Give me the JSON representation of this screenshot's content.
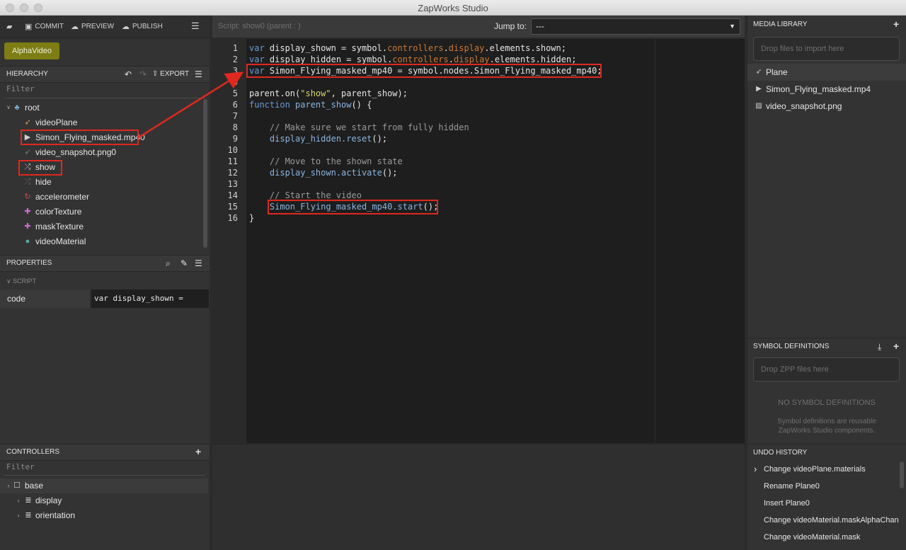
{
  "window": {
    "title": "ZapWorks Studio"
  },
  "toolbar": {
    "commit": "COMMIT",
    "preview": "PREVIEW",
    "publish": "PUBLISH"
  },
  "symbol_button": "AlphaVideo",
  "hierarchy": {
    "title": "HIERARCHY",
    "export": "EXPORT",
    "filter_placeholder": "Filter",
    "root": "root",
    "items": [
      {
        "label": "videoPlane",
        "icon": "rocket-icon"
      },
      {
        "label": "Simon_Flying_masked.mp40",
        "icon": "video-icon"
      },
      {
        "label": "video_snapshot.png0",
        "icon": "rocket-icon"
      },
      {
        "label": "show",
        "icon": "shuffle-icon"
      },
      {
        "label": "hide",
        "icon": "shuffle-icon"
      },
      {
        "label": "accelerometer",
        "icon": "refresh-icon"
      },
      {
        "label": "colorTexture",
        "icon": "cross-icon"
      },
      {
        "label": "maskTexture",
        "icon": "cross-icon"
      },
      {
        "label": "videoMaterial",
        "icon": "drop-icon"
      }
    ]
  },
  "properties": {
    "title": "PROPERTIES",
    "section": "SCRIPT",
    "key": "code",
    "value": "var display_shown ="
  },
  "controllers": {
    "title": "CONTROLLERS",
    "filter_placeholder": "Filter",
    "items": [
      "base",
      "display",
      "orientation"
    ]
  },
  "editor": {
    "script_label": "Script: show0 (parent : )",
    "jump_label": "Jump to:",
    "jump_value": "---",
    "line_numbers": [
      "1",
      "2",
      "3",
      "4",
      "5",
      "6",
      "7",
      "8",
      "9",
      "10",
      "11",
      "12",
      "13",
      "14",
      "15",
      "16"
    ]
  },
  "media_library": {
    "title": "MEDIA LIBRARY",
    "dropzone": "Drop files to import here",
    "items": [
      "Plane",
      "Simon_Flying_masked.mp4",
      "video_snapshot.png"
    ]
  },
  "symbol_definitions": {
    "title": "SYMBOL DEFINITIONS",
    "dropzone": "Drop ZPP files here",
    "empty_title": "NO SYMBOL DEFINITIONS",
    "empty_desc_1": "Symbol definitions are reusable",
    "empty_desc_2": "ZapWorks Studio components."
  },
  "undo_history": {
    "title": "UNDO HISTORY",
    "items": [
      "Change videoPlane.materials",
      "Rename Plane0",
      "Insert Plane0",
      "Change videoMaterial.maskAlphaChannel",
      "Change videoMaterial.mask"
    ]
  },
  "colors": {
    "accent_symbol": "#7d7d14",
    "callout_red": "#e0281e"
  }
}
